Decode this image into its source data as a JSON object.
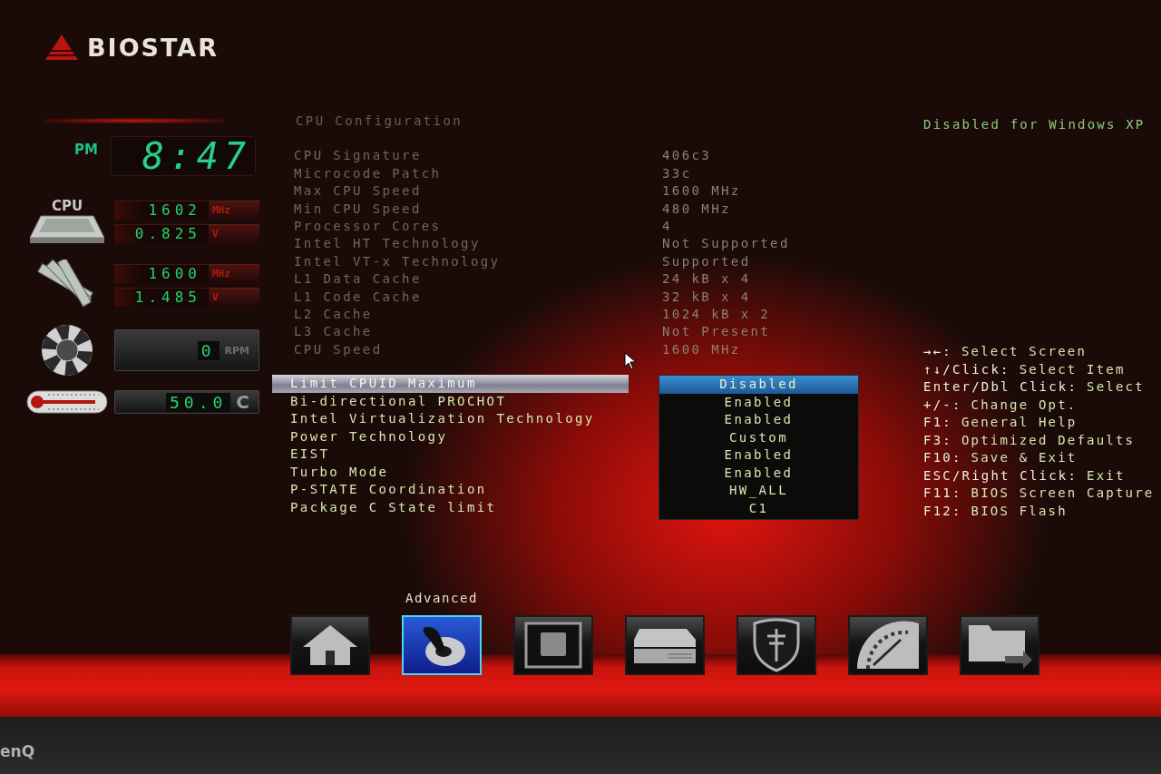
{
  "logo": {
    "text": "BIOSTAR"
  },
  "clock": {
    "period": "PM",
    "time": "8:47"
  },
  "monitors": [
    {
      "kind": "cpu",
      "label": "CPU",
      "readings": [
        {
          "value": "1602",
          "unit": "MHz"
        },
        {
          "value": "0.825",
          "unit": "V"
        }
      ]
    },
    {
      "kind": "memory",
      "readings": [
        {
          "value": "1600",
          "unit": "MHz"
        },
        {
          "value": "1.485",
          "unit": "V"
        }
      ]
    },
    {
      "kind": "fan",
      "readings": [
        {
          "value": "0",
          "unit": "RPM"
        }
      ]
    },
    {
      "kind": "temperature",
      "readings": [
        {
          "value": "50.0",
          "unit": "C"
        }
      ]
    }
  ],
  "section_title": "CPU Configuration",
  "info_rows": [
    {
      "label": "CPU Signature",
      "value": "406c3"
    },
    {
      "label": "Microcode Patch",
      "value": "33c"
    },
    {
      "label": "Max CPU Speed",
      "value": "1600 MHz"
    },
    {
      "label": "Min CPU Speed",
      "value": "480 MHz"
    },
    {
      "label": "Processor Cores",
      "value": "4"
    },
    {
      "label": "Intel HT Technology",
      "value": "Not Supported"
    },
    {
      "label": "Intel VT-x Technology",
      "value": "Supported"
    },
    {
      "label": "L1 Data Cache",
      "value": "24 kB x 4"
    },
    {
      "label": "L1 Code Cache",
      "value": "32 kB x 4"
    },
    {
      "label": "L2 Cache",
      "value": "1024 kB x 2"
    },
    {
      "label": "L3 Cache",
      "value": "Not Present"
    },
    {
      "label": "CPU Speed",
      "value": "1600 MHz"
    }
  ],
  "settings": [
    {
      "label": "Limit CPUID Maximum",
      "value": "Disabled",
      "selected": true
    },
    {
      "label": "Bi-directional PROCHOT",
      "value": "Enabled",
      "selected": false
    },
    {
      "label": "Intel Virtualization Technology",
      "value": "Enabled",
      "selected": false
    },
    {
      "label": "Power Technology",
      "value": "Custom",
      "selected": false
    },
    {
      "label": "EIST",
      "value": "Enabled",
      "selected": false
    },
    {
      "label": "Turbo Mode",
      "value": "Enabled",
      "selected": false
    },
    {
      "label": "P-STATE Coordination",
      "value": "HW_ALL",
      "selected": false
    },
    {
      "label": "Package C State limit",
      "value": "C1",
      "selected": false
    }
  ],
  "help_text": "Disabled for Windows XP",
  "keys": [
    {
      "key": "→←:",
      "action": "Select Screen"
    },
    {
      "key": "↑↓/Click:",
      "action": "Select Item"
    },
    {
      "key": "Enter/Dbl Click:",
      "action": "Select"
    },
    {
      "key": "+/-:",
      "action": "Change Opt."
    },
    {
      "key": "F1:",
      "action": "General Help"
    },
    {
      "key": "F3:",
      "action": "Optimized Defaults"
    },
    {
      "key": "F10:",
      "action": "Save & Exit"
    },
    {
      "key": "ESC/Right Click:",
      "action": "Exit"
    },
    {
      "key": "F11:",
      "action": "BIOS Screen Capture"
    },
    {
      "key": "F12:",
      "action": "BIOS Flash"
    }
  ],
  "nav_tabs": [
    {
      "kind": "house",
      "selected": false
    },
    {
      "kind": "lever",
      "label": "Advanced",
      "selected": true
    },
    {
      "kind": "square",
      "selected": false
    },
    {
      "kind": "drives",
      "selected": false
    },
    {
      "kind": "shield",
      "selected": false
    },
    {
      "kind": "gauge",
      "selected": false
    },
    {
      "kind": "folder",
      "selected": false
    }
  ],
  "bezel": {
    "brand": "enQ"
  }
}
